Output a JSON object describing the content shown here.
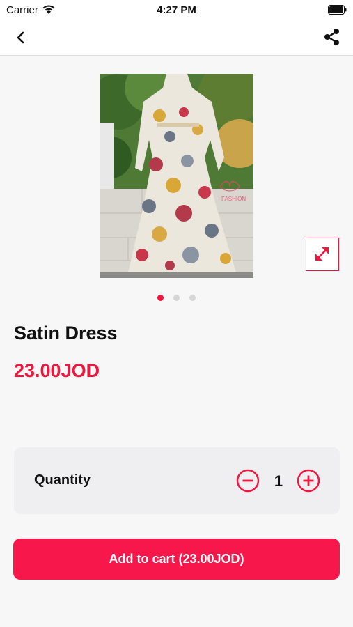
{
  "status_bar": {
    "carrier": "Carrier",
    "time": "4:27 PM"
  },
  "nav": {
    "back_icon": "chevron-left-icon",
    "share_icon": "share-icon"
  },
  "gallery": {
    "image_description_icon": "product-photo",
    "watermark_text": "FASHION",
    "page_count": 3,
    "active_page": 1,
    "expand_icon": "expand-arrows-icon"
  },
  "product": {
    "title": "Satin Dress",
    "price": "23.00JOD"
  },
  "quantity": {
    "label": "Quantity",
    "value": "1"
  },
  "cart": {
    "button_label": "Add to cart (23.00JOD)"
  },
  "colors": {
    "accent": "#f0173f",
    "button": "#f8174a",
    "background": "#f7f7f7",
    "card": "#efeff2"
  }
}
